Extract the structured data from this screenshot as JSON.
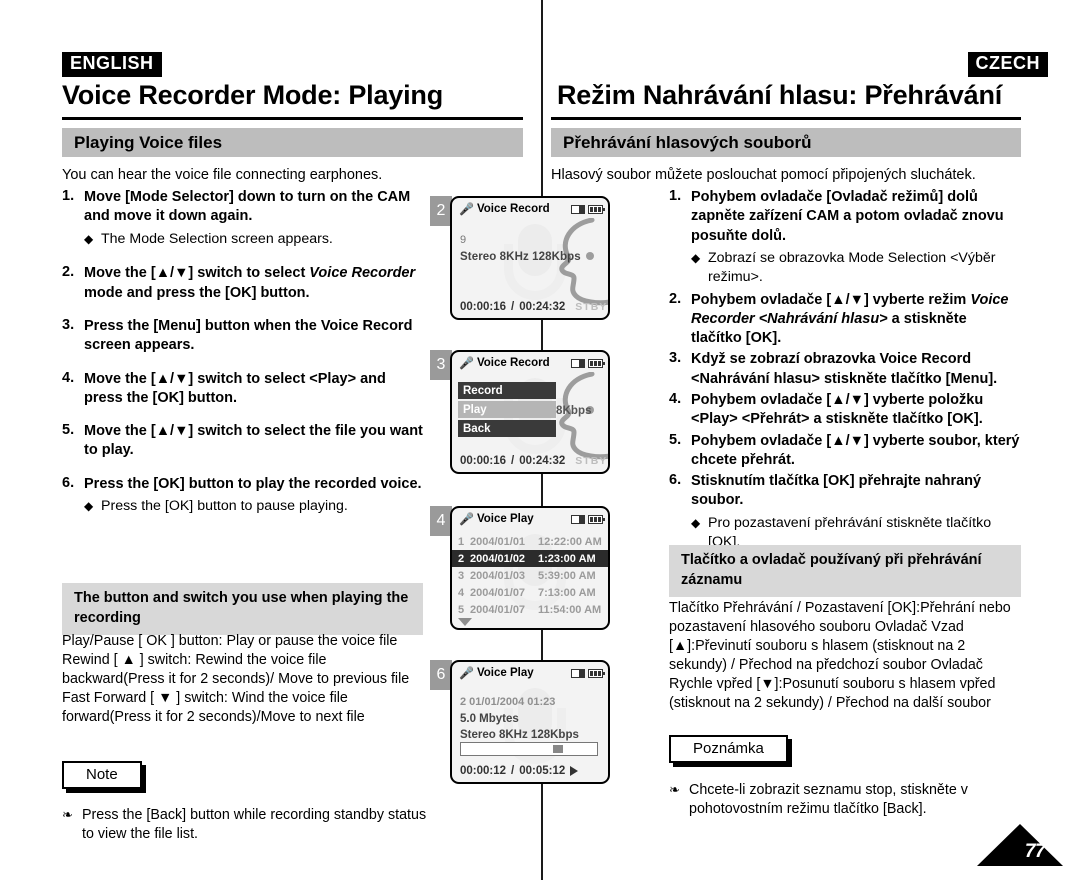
{
  "english": {
    "lang_tag": "ENGLISH",
    "chapter_title": "Voice Recorder Mode: Playing",
    "section_heading": "Playing Voice files",
    "intro": "You can hear the voice file connecting earphones.",
    "steps": [
      {
        "num": "1.",
        "text": "Move [Mode Selector] down to turn on the CAM and move it down again.",
        "bullets": [
          "The Mode Selection screen appears."
        ]
      },
      {
        "num": "2.",
        "text_pre": "Move the [▲/▼] switch to select ",
        "text_italic": "Voice Recorder",
        "text_post": " mode and press the [OK] button.",
        "bullets": []
      },
      {
        "num": "3.",
        "text": "Press the [Menu] button when the Voice Record screen appears.",
        "bullets": []
      },
      {
        "num": "4.",
        "text": "Move the [▲/▼] switch to select <Play> and press the [OK] button.",
        "bullets": []
      },
      {
        "num": "5.",
        "text": "Move the [▲/▼] switch to select the file you want to play.",
        "bullets": []
      },
      {
        "num": "6.",
        "text": "Press the [OK] button to play the recorded voice.",
        "bullets": [
          "Press the [OK] button to pause playing."
        ]
      }
    ],
    "subsection_heading": "The button and switch you use when playing the recording",
    "subsection_body": "Play/Pause [ OK ] button: Play or pause the voice file Rewind [ ▲ ] switch: Rewind the voice file backward(Press it for 2 seconds)/ Move to previous file Fast Forward [ ▼ ] switch: Wind the voice file forward(Press it for 2 seconds)/Move to next file",
    "note_label": "Note",
    "note_text": "Press the [Back] button while recording standby status to view the file list."
  },
  "czech": {
    "lang_tag": "CZECH",
    "chapter_title": "Režim Nahrávání hlasu: Přehrávání",
    "section_heading": "Přehrávání hlasových souborů",
    "intro": "Hlasový soubor můžete poslouchat pomocí připojených sluchátek.",
    "steps": [
      {
        "num": "1.",
        "text": "Pohybem ovladače [Ovladač režimů] dolů zapněte zařízení CAM a potom ovladač znovu posuňte dolů.",
        "bullets": [
          "Zobrazí se obrazovka Mode Selection <Výběr režimu>."
        ]
      },
      {
        "num": "2.",
        "text_pre": "Pohybem ovladače [▲/▼] vyberte  režim ",
        "text_italic": "Voice Recorder <Nahrávání hlasu>",
        "text_post": " a stiskněte tlačítko [OK].",
        "bullets": []
      },
      {
        "num": "3.",
        "text": "Když se zobrazí obrazovka Voice Record <Nahrávání hlasu> stiskněte tlačítko [Menu].",
        "bullets": []
      },
      {
        "num": "4.",
        "text": "Pohybem ovladače [▲/▼] vyberte položku <Play> <Přehrát> a stiskněte tlačítko [OK].",
        "bullets": []
      },
      {
        "num": "5.",
        "text": "Pohybem ovladače [▲/▼] vyberte soubor, který chcete přehrát.",
        "bullets": []
      },
      {
        "num": "6.",
        "text": "Stisknutím tlačítka [OK] přehrajte nahraný soubor.",
        "bullets": [
          "Pro pozastavení přehrávání stiskněte tlačítko [OK]."
        ]
      }
    ],
    "subsection_heading": "Tlačítko a ovladač používaný při přehrávání záznamu",
    "subsection_body": "Tlačítko Přehrávání / Pozastavení [OK]:Přehrání nebo pozastavení hlasového souboru Ovladač Vzad [▲]:Převinutí souboru s hlasem (stisknout na 2 sekundy) / Přechod na předchozí soubor Ovladač Rychle vpřed [▼]:Posunutí souboru s hlasem vpřed (stisknout na 2 sekundy) / Přechod na další soubor",
    "note_label": "Poznámka",
    "note_text": "Chcete-li zobrazit seznamu stop, stiskněte v pohotovostním režimu tlačítko [Back]."
  },
  "screens": [
    {
      "badge": "2",
      "title": "Voice Record",
      "file_number": "9",
      "format": "Stereo  8KHz  128Kbps",
      "elapsed": "00:00:16",
      "separator": "/",
      "total": "00:24:32",
      "status": "STBY"
    },
    {
      "badge": "3",
      "title": "Voice Record",
      "format_partial": "8Kbps",
      "menu": [
        {
          "label": "Record",
          "selected": false
        },
        {
          "label": "Play",
          "selected": true
        },
        {
          "label": "Back",
          "selected": false
        }
      ],
      "elapsed": "00:00:16",
      "separator": "/",
      "total": "00:24:32",
      "status": "STBY"
    },
    {
      "badge": "4",
      "title": "Voice Play",
      "files": [
        {
          "idx": "1",
          "date": "2004/01/01",
          "time": "12:22:00 AM",
          "selected": false
        },
        {
          "idx": "2",
          "date": "2004/01/02",
          "time": "1:23:00 AM",
          "selected": true
        },
        {
          "idx": "3",
          "date": "2004/01/03",
          "time": "5:39:00 AM",
          "selected": false
        },
        {
          "idx": "4",
          "date": "2004/01/07",
          "time": "7:13:00 AM",
          "selected": false
        },
        {
          "idx": "5",
          "date": "2004/01/07",
          "time": "11:54:00 AM",
          "selected": false
        }
      ]
    },
    {
      "badge": "6",
      "title": "Voice Play",
      "file_line": "2  01/01/2004  01:23",
      "size": "5.0 Mbytes",
      "format": "Stereo  8KHz  128Kbps",
      "elapsed": "00:00:12",
      "separator": "/",
      "total": "00:05:12"
    }
  ],
  "page_number": "77",
  "colors": {
    "section_bar": "#bdbdbd",
    "subhead_bar": "#d8d8d8",
    "badge": "#9a9a9a",
    "lcd_bg": "#f3f3f3",
    "selected_row": "#2b2b2b"
  }
}
